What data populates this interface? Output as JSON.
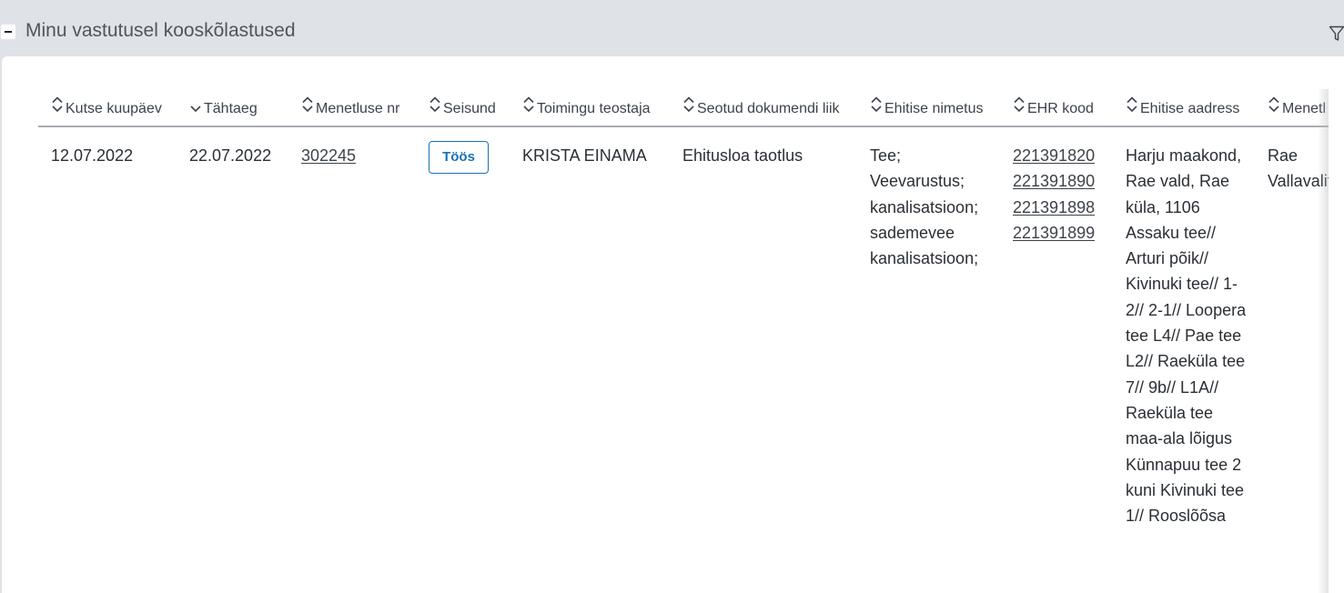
{
  "header": {
    "collapse_icon": "minus-icon",
    "title": "Minu vastutusel kooskõlastused",
    "filter_icon": "filter-icon"
  },
  "table": {
    "columns": [
      {
        "label": "Kutse kuupäev",
        "sort_icon": "sort-both-icon"
      },
      {
        "label": "Tähtaeg",
        "sort_icon": "sort-down-icon"
      },
      {
        "label": "Menetluse nr",
        "sort_icon": "sort-both-icon"
      },
      {
        "label": "Seisund",
        "sort_icon": "sort-both-icon"
      },
      {
        "label": "Toimingu teostaja",
        "sort_icon": "sort-both-icon"
      },
      {
        "label": "Seotud dokumendi liik",
        "sort_icon": "sort-both-icon"
      },
      {
        "label": "Ehitise nimetus",
        "sort_icon": "sort-both-icon"
      },
      {
        "label": "EHR kood",
        "sort_icon": "sort-both-icon"
      },
      {
        "label": "Ehitise aadress",
        "sort_icon": "sort-both-icon"
      },
      {
        "label": "Menetl",
        "sort_icon": "sort-both-icon"
      }
    ],
    "rows": [
      {
        "kutse_kuupaev": "12.07.2022",
        "tahtaeg": "22.07.2022",
        "menetluse_nr": "302245",
        "seisund": "Töös",
        "toimingu_teostaja": "KRISTA EINAMA",
        "seotud_dokumendi_liik": "Ehitusloa taotlus",
        "ehitise_nimetus": "Tee; Veevarustus; kanalisatsioon; sademevee kanalisatsioon;",
        "ehr_koodid": [
          "221391820",
          "221391890",
          "221391898",
          "221391899"
        ],
        "ehitise_aadress": "Harju maakond, Rae vald, Rae küla, 1106 Assaku tee// Arturi põik// Kivinuki tee// 1-2// 2-1// Loopera tee L4// Pae tee L2// Raeküla tee 7// 9b// L1A// Raeküla tee maa-ala lõigus Künnapuu tee 2 kuni Kivinuki tee 1// Rooslõõsa",
        "menetleja": "Rae Vallavalitsus"
      }
    ]
  },
  "colors": {
    "header_bg": "#dfe2e6",
    "accent_blue": "#1971b5",
    "text": "#2a2f35"
  }
}
